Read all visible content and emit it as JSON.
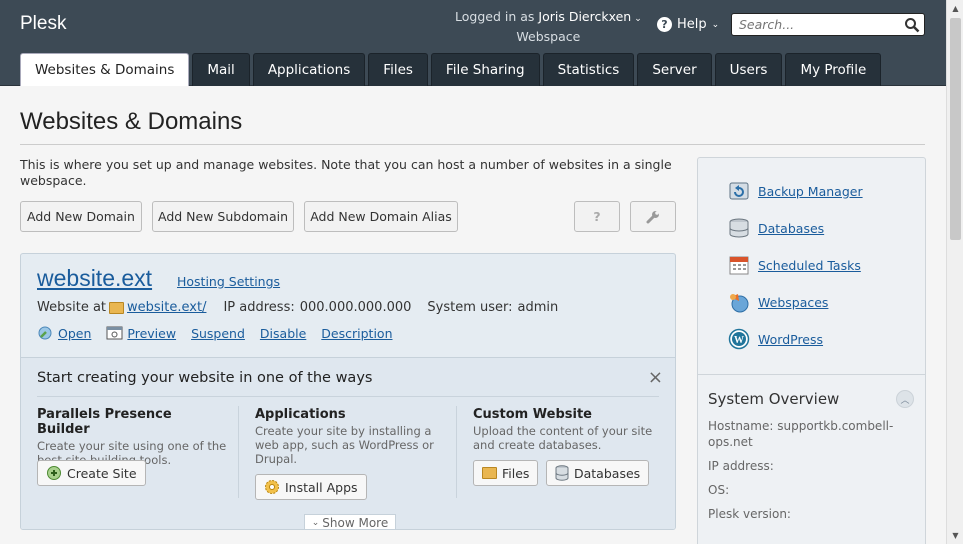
{
  "header": {
    "logo": "Plesk",
    "logged_in_as": "Logged in as",
    "user_name": "Joris Dierckxen",
    "user_chevron": "⌄",
    "webspace_label": "Webspace",
    "help_label": "Help",
    "help_chevron": "⌄",
    "search_placeholder": "Search..."
  },
  "tabs": [
    {
      "label": "Websites & Domains",
      "active": true
    },
    {
      "label": "Mail"
    },
    {
      "label": "Applications"
    },
    {
      "label": "Files"
    },
    {
      "label": "File Sharing"
    },
    {
      "label": "Statistics"
    },
    {
      "label": "Server"
    },
    {
      "label": "Users"
    },
    {
      "label": "My Profile"
    }
  ],
  "page": {
    "title": "Websites & Domains",
    "description": "This is where you set up and manage websites. Note that you can host a number of websites in a single webspace."
  },
  "toolbar": {
    "add_domain": "Add New Domain",
    "add_subdomain": "Add New Subdomain",
    "add_alias": "Add New Domain Alias",
    "help_icon": "?"
  },
  "domain": {
    "name": "website.ext",
    "hosting_settings": "Hosting Settings",
    "website_at_label": "Website at",
    "website_path": "website.ext/",
    "ip_label": "IP address:",
    "ip_value": "000.000.000.000",
    "sysuser_label": "System user:",
    "sysuser_value": "admin",
    "links": {
      "open": "Open",
      "preview": "Preview",
      "suspend": "Suspend",
      "disable": "Disable",
      "description": "Description"
    }
  },
  "start": {
    "title": "Start creating your website in one of the ways",
    "close": "×",
    "builder": {
      "title": "Parallels Presence Builder",
      "text": "Create your site using one of the best site building tools.",
      "button": "Create Site"
    },
    "apps": {
      "title": "Applications",
      "text": "Create your site by installing a web app, such as WordPress or Drupal.",
      "button": "Install Apps"
    },
    "custom": {
      "title": "Custom Website",
      "text": "Upload the content of your site and create databases.",
      "files_button": "Files",
      "db_button": "Databases"
    },
    "show_more": "Show More"
  },
  "sidebar": {
    "links": [
      {
        "label": "Backup Manager",
        "icon": "backup-icon"
      },
      {
        "label": "Databases",
        "icon": "database-icon"
      },
      {
        "label": "Scheduled Tasks",
        "icon": "calendar-icon"
      },
      {
        "label": "Webspaces",
        "icon": "webspaces-icon"
      },
      {
        "label": "WordPress",
        "icon": "wordpress-icon"
      }
    ],
    "system_overview": {
      "title": "System Overview",
      "hostname_label": "Hostname:",
      "hostname_value": "supportkb.combell-ops.net",
      "ip_label": "IP address:",
      "os_label": "OS:",
      "plesk_label": "Plesk version:"
    }
  },
  "colors": {
    "header_bg": "#3d4a55",
    "tab_bg": "#26313a",
    "link": "#1a5c9c",
    "domain_box_bg": "#e5ecf2"
  }
}
